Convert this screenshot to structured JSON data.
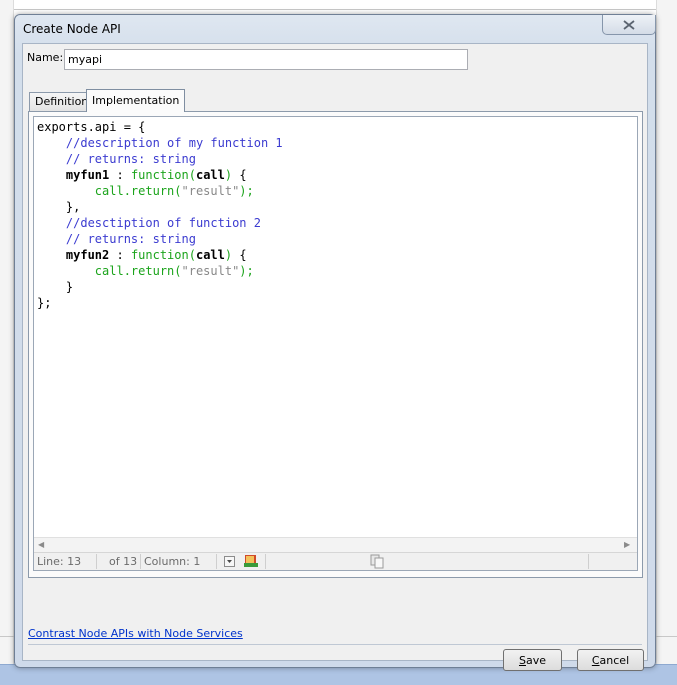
{
  "window": {
    "title": "Create Node API"
  },
  "form": {
    "name_label": "Name:",
    "name_value": "myapi"
  },
  "tabs": [
    {
      "label": "Definition"
    },
    {
      "label": "Implementation"
    }
  ],
  "editor": {
    "code_lines": [
      [
        {
          "t": "exports.api = {",
          "c": "kw"
        }
      ],
      [
        {
          "t": "    //description of my function 1",
          "c": "cm"
        }
      ],
      [
        {
          "t": "    // returns: string",
          "c": "cm"
        }
      ],
      [
        {
          "t": "    myfun1",
          "c": "bd"
        },
        {
          "t": " : ",
          "c": "kw"
        },
        {
          "t": "function(",
          "c": "fn"
        },
        {
          "t": "call",
          "c": "bd"
        },
        {
          "t": ")",
          "c": "fn"
        },
        {
          "t": " {",
          "c": "kw"
        }
      ],
      [
        {
          "t": "        call.return(",
          "c": "fn"
        },
        {
          "t": "\"result\"",
          "c": "st"
        },
        {
          "t": ");",
          "c": "fn"
        }
      ],
      [
        {
          "t": "    },",
          "c": "kw"
        }
      ],
      [
        {
          "t": "    //desctiption of function 2",
          "c": "cm"
        }
      ],
      [
        {
          "t": "    // returns: string",
          "c": "cm"
        }
      ],
      [
        {
          "t": "    myfun2",
          "c": "bd"
        },
        {
          "t": " : ",
          "c": "kw"
        },
        {
          "t": "function(",
          "c": "fn"
        },
        {
          "t": "call",
          "c": "bd"
        },
        {
          "t": ")",
          "c": "fn"
        },
        {
          "t": " {",
          "c": "kw"
        }
      ],
      [
        {
          "t": "        call.return(",
          "c": "fn"
        },
        {
          "t": "\"result\"",
          "c": "st"
        },
        {
          "t": ");",
          "c": "fn"
        }
      ],
      [
        {
          "t": "    }",
          "c": "kw"
        }
      ],
      [
        {
          "t": "};",
          "c": "kw"
        }
      ]
    ],
    "status": {
      "line": "Line: 13",
      "of": "of 13",
      "column": "Column: 1"
    }
  },
  "links": {
    "help": "Contrast Node APIs with Node Services"
  },
  "buttons": {
    "save": "Save",
    "cancel": "Cancel"
  },
  "colors": {
    "comment": "#3b3bd0",
    "function": "#1ca41c",
    "string": "#888888",
    "link": "#0033cc"
  },
  "icons": [
    "close-icon",
    "dropdown-icon",
    "book-icon",
    "copy-icon",
    "scroll-left-icon",
    "scroll-right-icon"
  ]
}
